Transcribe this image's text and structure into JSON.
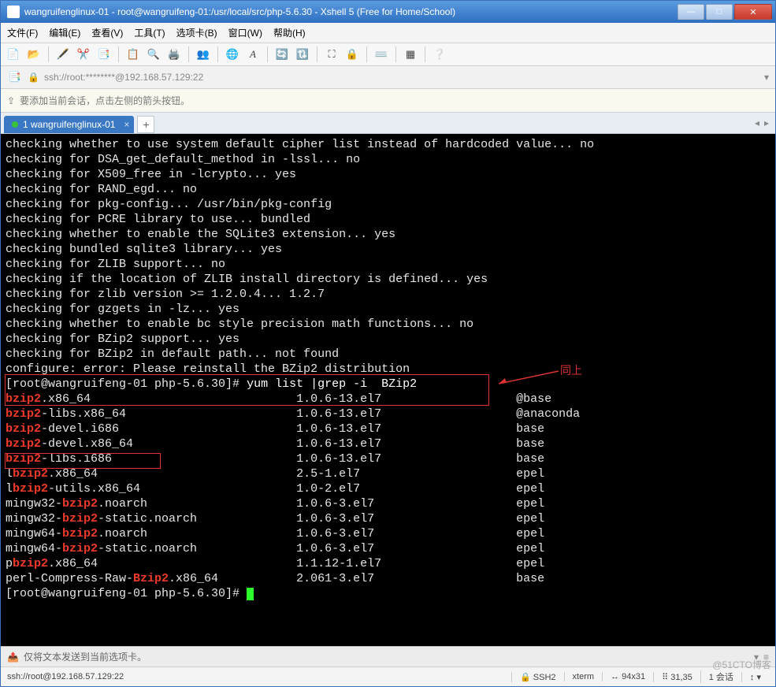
{
  "window": {
    "title": "wangruifenglinux-01 - root@wangruifeng-01:/usr/local/src/php-5.6.30 - Xshell 5 (Free for Home/School)"
  },
  "menu": {
    "file": "文件(F)",
    "edit": "编辑(E)",
    "view": "查看(V)",
    "tools": "工具(T)",
    "tabs": "选项卡(B)",
    "window": "窗口(W)",
    "help": "帮助(H)"
  },
  "address": "ssh://root:********@192.168.57.129:22",
  "hint": "要添加当前会话，点击左侧的箭头按钮。",
  "tab": {
    "label": "1 wangruifenglinux-01"
  },
  "annotation": "同上",
  "terminal_lines": [
    [
      {
        "t": "checking whether to use system default cipher list instead of hardcoded value... no"
      }
    ],
    [
      {
        "t": "checking for DSA_get_default_method in -lssl... no"
      }
    ],
    [
      {
        "t": "checking for X509_free in -lcrypto... yes"
      }
    ],
    [
      {
        "t": "checking for RAND_egd... no"
      }
    ],
    [
      {
        "t": "checking for pkg-config... /usr/bin/pkg-config"
      }
    ],
    [
      {
        "t": "checking for PCRE library to use... bundled"
      }
    ],
    [
      {
        "t": "checking whether to enable the SQLite3 extension... yes"
      }
    ],
    [
      {
        "t": "checking bundled sqlite3 library... yes"
      }
    ],
    [
      {
        "t": "checking for ZLIB support... no"
      }
    ],
    [
      {
        "t": "checking if the location of ZLIB install directory is defined... yes"
      }
    ],
    [
      {
        "t": "checking for zlib version >= 1.2.0.4... 1.2.7"
      }
    ],
    [
      {
        "t": "checking for gzgets in -lz... yes"
      }
    ],
    [
      {
        "t": "checking whether to enable bc style precision math functions... no"
      }
    ],
    [
      {
        "t": "checking for BZip2 support... yes"
      }
    ],
    [
      {
        "t": "checking for BZip2 in default path... not found"
      }
    ],
    [
      {
        "t": "configure: error: Please reinstall the BZip2 distribution"
      }
    ],
    [
      {
        "t": "[root@wangruifeng-01 php-5.6.30]# "
      },
      {
        "t": "yum list |grep -i  BZip2",
        "c": "t-cmd"
      }
    ],
    [
      {
        "t": "bzip2",
        "c": "t-red"
      },
      {
        "t": ".x86_64                             1.0.6-13.el7                   @base"
      }
    ],
    [
      {
        "t": "bzip2",
        "c": "t-red"
      },
      {
        "t": "-libs.x86_64                        1.0.6-13.el7                   @anaconda"
      }
    ],
    [
      {
        "t": "bzip2",
        "c": "t-red"
      },
      {
        "t": "-devel.i686                         1.0.6-13.el7                   base"
      }
    ],
    [
      {
        "t": "bzip2",
        "c": "t-red"
      },
      {
        "t": "-devel.x86_64                       1.0.6-13.el7                   base"
      }
    ],
    [
      {
        "t": "bzip2",
        "c": "t-red"
      },
      {
        "t": "-libs.i686                          1.0.6-13.el7                   base"
      }
    ],
    [
      {
        "t": "l"
      },
      {
        "t": "bzip2",
        "c": "t-red"
      },
      {
        "t": ".x86_64                            2.5-1.el7                      epel"
      }
    ],
    [
      {
        "t": "l"
      },
      {
        "t": "bzip2",
        "c": "t-red"
      },
      {
        "t": "-utils.x86_64                      1.0-2.el7                      epel"
      }
    ],
    [
      {
        "t": "mingw32-"
      },
      {
        "t": "bzip2",
        "c": "t-red"
      },
      {
        "t": ".noarch                     1.0.6-3.el7                    epel"
      }
    ],
    [
      {
        "t": "mingw32-"
      },
      {
        "t": "bzip2",
        "c": "t-red"
      },
      {
        "t": "-static.noarch              1.0.6-3.el7                    epel"
      }
    ],
    [
      {
        "t": "mingw64-"
      },
      {
        "t": "bzip2",
        "c": "t-red"
      },
      {
        "t": ".noarch                     1.0.6-3.el7                    epel"
      }
    ],
    [
      {
        "t": "mingw64-"
      },
      {
        "t": "bzip2",
        "c": "t-red"
      },
      {
        "t": "-static.noarch              1.0.6-3.el7                    epel"
      }
    ],
    [
      {
        "t": "p"
      },
      {
        "t": "bzip2",
        "c": "t-red"
      },
      {
        "t": ".x86_64                            1.1.12-1.el7                   epel"
      }
    ],
    [
      {
        "t": "perl-Compress-Raw-"
      },
      {
        "t": "Bzip2",
        "c": "t-red"
      },
      {
        "t": ".x86_64           2.061-3.el7                    base"
      }
    ],
    [
      {
        "t": "[root@wangruifeng-01 php-5.6.30]# "
      },
      {
        "cursor": true
      }
    ]
  ],
  "status_send": "仅将文本发送到当前选项卡。",
  "status": {
    "conn": "ssh://root@192.168.57.129:22",
    "proto": "SSH2",
    "term": "xterm",
    "size": "94x31",
    "pos": "31,35",
    "sessions": "1 会话"
  },
  "watermark": "@51CTO博客"
}
